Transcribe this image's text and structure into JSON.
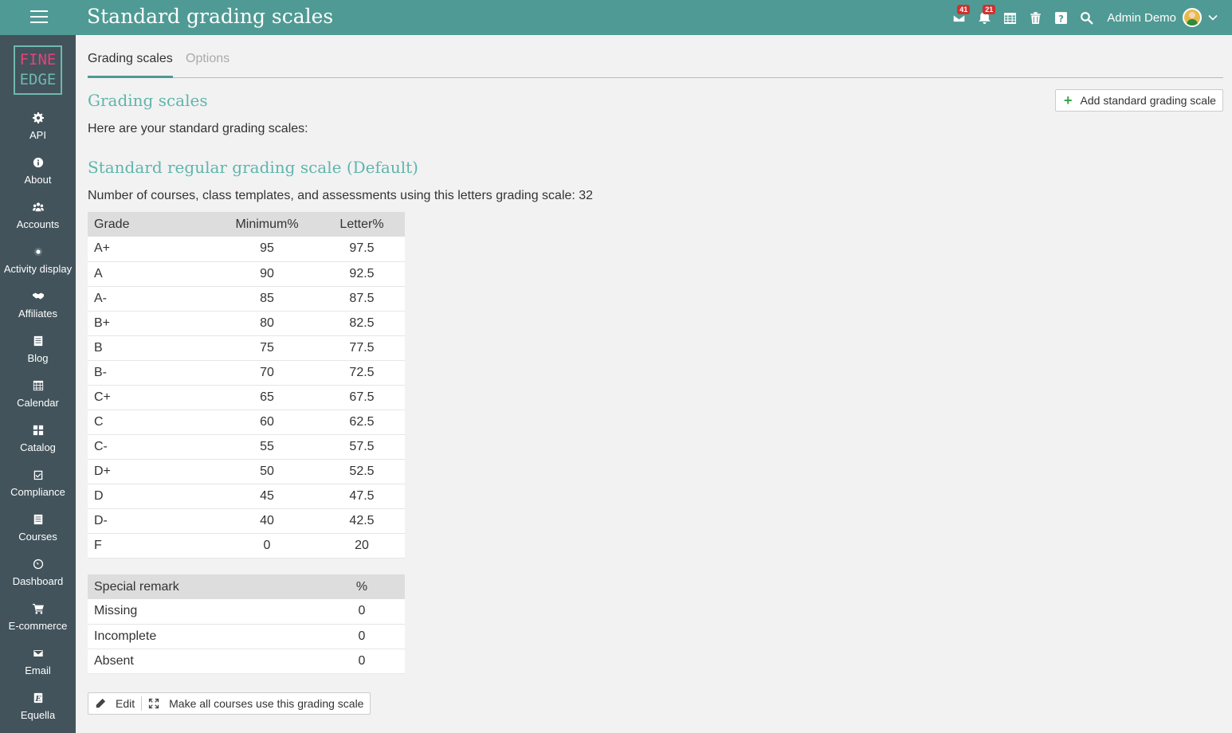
{
  "header": {
    "title": "Standard grading scales",
    "messages_badge": "41",
    "notifications_badge": "21",
    "user_name": "Admin Demo"
  },
  "logo": {
    "line1": "FINE",
    "line2": "EDGE"
  },
  "sidebar": {
    "items": [
      {
        "label": "API",
        "icon": "gear-icon"
      },
      {
        "label": "About",
        "icon": "info-icon"
      },
      {
        "label": "Accounts",
        "icon": "users-icon"
      },
      {
        "label": "Activity display",
        "icon": "dot-icon"
      },
      {
        "label": "Affiliates",
        "icon": "handshake-icon"
      },
      {
        "label": "Blog",
        "icon": "document-icon"
      },
      {
        "label": "Calendar",
        "icon": "calendar-icon"
      },
      {
        "label": "Catalog",
        "icon": "grid-icon"
      },
      {
        "label": "Compliance",
        "icon": "checklist-icon"
      },
      {
        "label": "Courses",
        "icon": "list-icon"
      },
      {
        "label": "Dashboard",
        "icon": "gauge-icon"
      },
      {
        "label": "E-commerce",
        "icon": "cart-icon"
      },
      {
        "label": "Email",
        "icon": "envelope-icon"
      },
      {
        "label": "Equella",
        "icon": "equella-icon"
      }
    ]
  },
  "tabs": {
    "active": "Grading scales",
    "inactive": "Options"
  },
  "section": {
    "title": "Grading scales",
    "add_button": "Add standard grading scale",
    "intro": "Here are your standard grading scales:"
  },
  "scale": {
    "title": "Standard regular grading scale (Default)",
    "usage": "Number of courses, class templates, and assessments using this letters grading scale: 32",
    "columns": [
      "Grade",
      "Minimum%",
      "Letter%"
    ],
    "rows": [
      [
        "A+",
        "95",
        "97.5"
      ],
      [
        "A",
        "90",
        "92.5"
      ],
      [
        "A-",
        "85",
        "87.5"
      ],
      [
        "B+",
        "80",
        "82.5"
      ],
      [
        "B",
        "75",
        "77.5"
      ],
      [
        "B-",
        "70",
        "72.5"
      ],
      [
        "C+",
        "65",
        "67.5"
      ],
      [
        "C",
        "60",
        "62.5"
      ],
      [
        "C-",
        "55",
        "57.5"
      ],
      [
        "D+",
        "50",
        "52.5"
      ],
      [
        "D",
        "45",
        "47.5"
      ],
      [
        "D-",
        "40",
        "42.5"
      ],
      [
        "F",
        "0",
        "20"
      ]
    ],
    "remark_columns": [
      "Special remark",
      "%"
    ],
    "remark_rows": [
      [
        "Missing",
        "0"
      ],
      [
        "Incomplete",
        "0"
      ],
      [
        "Absent",
        "0"
      ]
    ],
    "edit_label": "Edit",
    "make_all_label": "Make all courses use this grading scale"
  },
  "colors": {
    "header_bg": "#4f9a94",
    "sidebar_bg": "#42535b",
    "accent_teal": "#5fb5ad",
    "logo_pink": "#e0457b",
    "badge_red": "#d0312d"
  }
}
